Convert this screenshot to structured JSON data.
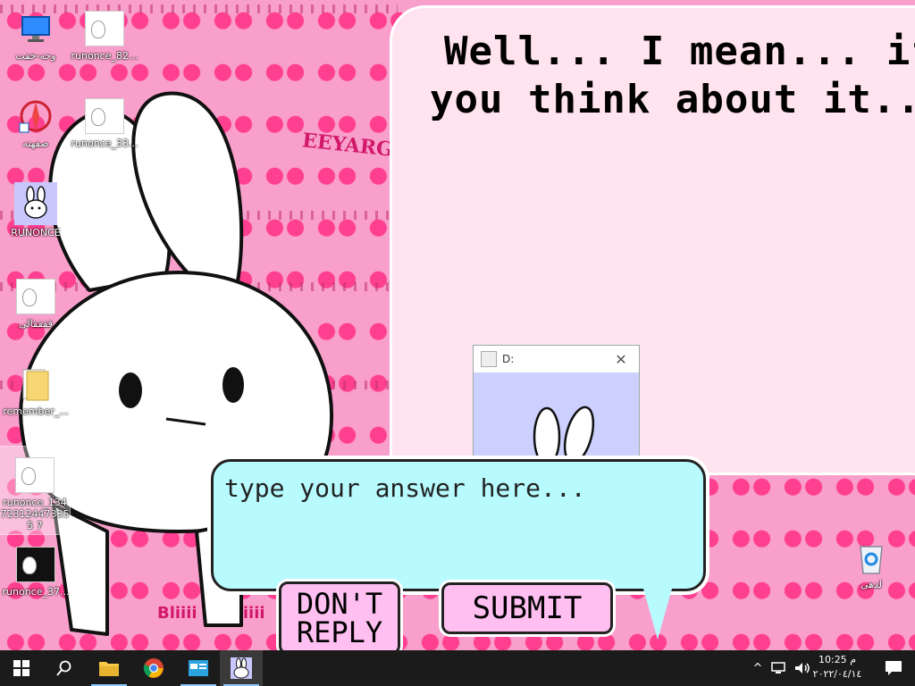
{
  "desktop_icons": [
    {
      "label": "وحه-خفت",
      "icon": "monitor-icon"
    },
    {
      "label": "runonce_82...",
      "icon": "image-file-icon"
    },
    {
      "label": "صفهته",
      "icon": "shortcut-icon"
    },
    {
      "label": "runonce_33...",
      "icon": "image-file-icon"
    },
    {
      "label": "RUNONCE",
      "icon": "bunny-app-icon"
    },
    {
      "label": "ققققالی",
      "icon": "image-file-icon"
    },
    {
      "label": "remember_...",
      "icon": "folder-icon"
    },
    {
      "label": "runonce_134 723124473355 7",
      "icon": "image-file-icon"
    },
    {
      "label": "runonce_37...",
      "icon": "image-file-icon"
    },
    {
      "label": "لدهی",
      "icon": "recycle-bin-icon"
    }
  ],
  "speech_bubble": {
    "line1": "Well... I mean... if",
    "line2": "you think about it..."
  },
  "small_window": {
    "title": "D:"
  },
  "answer_box": {
    "placeholder": "type your answer here..."
  },
  "buttons": {
    "dont_reply_line1": "DON'T",
    "dont_reply_line2": "REPLY",
    "submit": "SUBMIT"
  },
  "wallpaper_text": {
    "brand": "EEYARG!",
    "sign1": "Bliiii",
    "sign2": "Bliiii"
  },
  "taskbar": {
    "time": "10:25 م",
    "date": "٢٠٢٢/٠٤/١٤",
    "notification_count": "٢"
  },
  "colors": {
    "wallpaper": "#f99fcb",
    "bubble": "#ffe3ee",
    "answer_box": "#b7fbff",
    "button": "#ffbff0",
    "taskbar": "#1b1b1b"
  }
}
